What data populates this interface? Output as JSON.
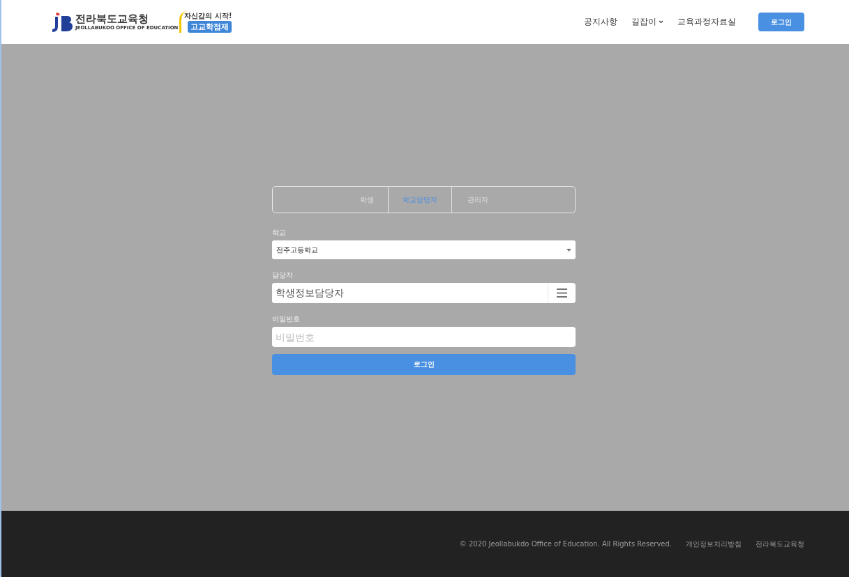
{
  "header": {
    "logo": {
      "name": "전라북도교육청",
      "subtitle": "JEOLLABUKDO OFFICE OF EDUCATION",
      "badge_tagline": "자신감의 시작!",
      "badge_title": "고교학점제"
    },
    "nav": [
      {
        "label": "공지사항",
        "dropdown": false
      },
      {
        "label": "길잡이",
        "dropdown": true
      },
      {
        "label": "교육과정자료실",
        "dropdown": false
      }
    ],
    "login_button": "로그인"
  },
  "tabs": [
    {
      "label": "학생",
      "selected": false
    },
    {
      "label": "학교담당자",
      "selected": true
    },
    {
      "label": "관리자",
      "selected": false
    }
  ],
  "form": {
    "school": {
      "label": "학교",
      "value": "전주고등학교"
    },
    "manager": {
      "label": "담당자",
      "value": "학생정보담당자"
    },
    "password": {
      "label": "비밀번호",
      "placeholder": "비밀번호"
    },
    "submit": "로그인"
  },
  "footer": {
    "copyright": "© 2020 Jeollabukdo Office of Education. All Rights Reserved.",
    "links": [
      "개인정보처리방침",
      "전라북도교육청"
    ]
  }
}
